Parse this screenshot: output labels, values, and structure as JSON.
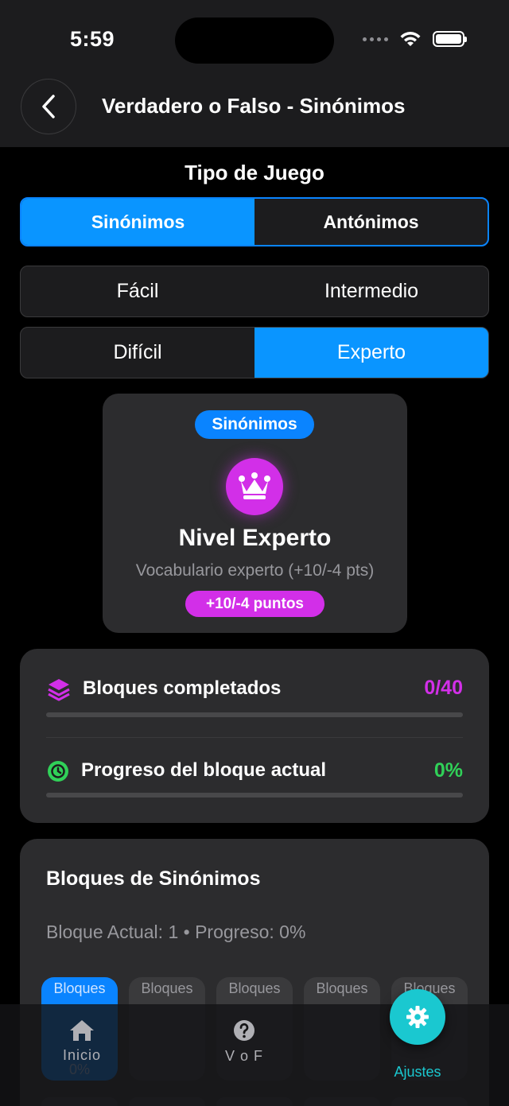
{
  "status_bar": {
    "time": "5:59"
  },
  "nav": {
    "title": "Verdadero o Falso - Sinónimos"
  },
  "game_type": {
    "title": "Tipo de Juego",
    "options": [
      "Sinónimos",
      "Antónimos"
    ],
    "selected": "Sinónimos"
  },
  "difficulty": {
    "options": [
      "Fácil",
      "Intermedio",
      "Difícil",
      "Experto"
    ],
    "selected": "Experto"
  },
  "level_card": {
    "badge": "Sinónimos",
    "icon": "crown-icon",
    "name": "Nivel Experto",
    "description": "Vocabulario experto (+10/-4 pts)",
    "points": "+10/-4 puntos",
    "accent": "#d22fe8"
  },
  "progress": {
    "blocks_label": "Bloques completados",
    "blocks_value": "0/40",
    "blocks_fraction": 0,
    "blocks_color": "#d22fe8",
    "current_label": "Progreso del bloque actual",
    "current_value": "0%",
    "current_fraction": 0,
    "current_color": "#30d158"
  },
  "blocks": {
    "title": "Bloques de Sinónimos",
    "subtitle": "Bloque Actual: 1 • Progreso: 0%",
    "tile_label": "Bloques",
    "first_tile_progress": "0%"
  },
  "tabbar": {
    "home_label": "Inicio",
    "vof_label": "V o F",
    "settings_label": "Ajustes",
    "accent": "#1ac8d0"
  }
}
